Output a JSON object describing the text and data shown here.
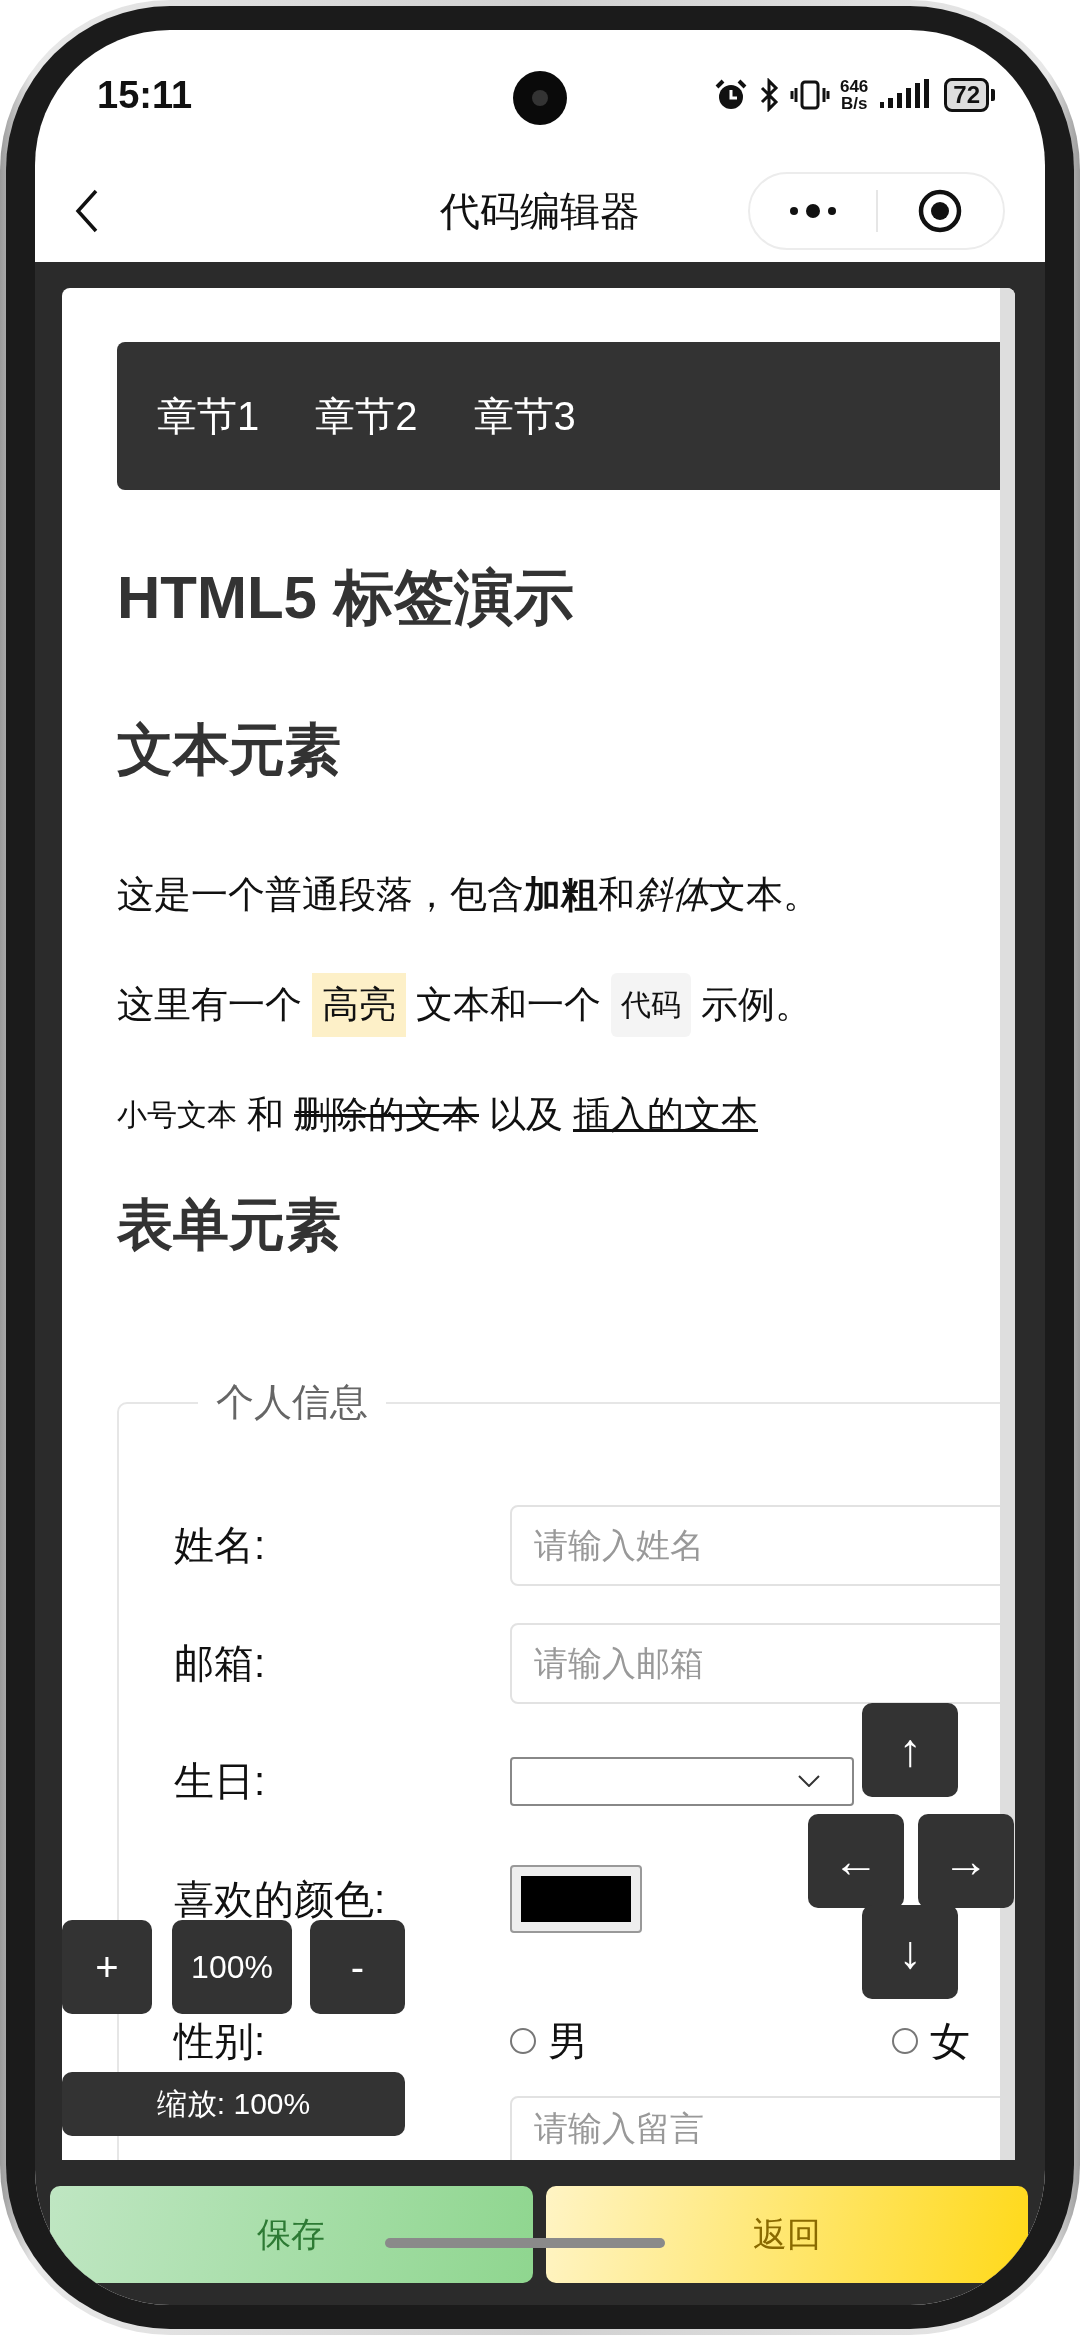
{
  "status_bar": {
    "time": "15:11",
    "net_speed": "646",
    "net_speed_unit": "B/s",
    "battery": "72"
  },
  "nav_bar": {
    "title": "代码编辑器"
  },
  "chapter_nav": [
    {
      "label": "章节1"
    },
    {
      "label": "章节2"
    },
    {
      "label": "章节3"
    }
  ],
  "page_title": "HTML5 标签演示",
  "text_section": {
    "heading": "文本元素",
    "paragraphs": [
      {
        "kind": "styled",
        "segments": [
          {
            "kind": "text",
            "text": "这是一个普通段落，包含"
          },
          {
            "kind": "bold",
            "text": "加粗"
          },
          {
            "kind": "text",
            "text": "和"
          },
          {
            "kind": "italic",
            "text": "斜体"
          },
          {
            "kind": "text",
            "text": "文本。"
          }
        ]
      },
      {
        "kind": "inline",
        "segments": [
          {
            "kind": "text",
            "text": "这里有一个"
          },
          {
            "kind": "mark",
            "text": "高亮"
          },
          {
            "kind": "text",
            "text": "文本和一个"
          },
          {
            "kind": "code",
            "text": "代码"
          },
          {
            "kind": "text",
            "text": "示例。"
          }
        ]
      },
      {
        "kind": "inline",
        "segments": [
          {
            "kind": "small",
            "text": "小号文本"
          },
          {
            "kind": "text",
            "text": "和"
          },
          {
            "kind": "del",
            "text": "删除的文本"
          },
          {
            "kind": "text",
            "text": "以及"
          },
          {
            "kind": "ins",
            "text": "插入的文本"
          }
        ]
      }
    ]
  },
  "form_section": {
    "heading": "表单元素",
    "legend": "个人信息",
    "fields": [
      {
        "kind": "text",
        "label": "姓名:",
        "placeholder": "请输入姓名"
      },
      {
        "kind": "text",
        "label": "邮箱:",
        "placeholder": "请输入邮箱"
      },
      {
        "kind": "date",
        "label": "生日:"
      },
      {
        "kind": "color",
        "label": "喜欢的颜色:"
      },
      {
        "kind": "radio",
        "label": "性别:",
        "options": [
          {
            "label": "男",
            "selected": false
          },
          {
            "label": "女",
            "selected": false
          }
        ]
      },
      {
        "kind": "textarea",
        "placeholder": "请输入留言"
      }
    ]
  },
  "zoom_controls": {
    "zoom_in": "+",
    "level": "100%",
    "zoom_out": "-",
    "status": "缩放: 100%"
  },
  "arrow_pad": [
    {
      "label": "↑"
    },
    {
      "label": "←"
    },
    {
      "label": "→"
    },
    {
      "label": "↓"
    }
  ],
  "bottom_buttons": [
    {
      "kind": "save",
      "label": "保存"
    },
    {
      "kind": "back",
      "label": "返回"
    }
  ]
}
